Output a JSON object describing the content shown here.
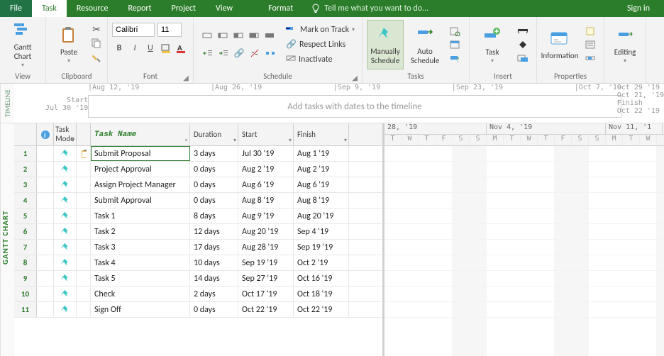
{
  "menu": {
    "file": "File",
    "task": "Task",
    "resource": "Resource",
    "report": "Report",
    "project": "Project",
    "view": "View",
    "format": "Format",
    "tellme": "Tell me what you want to do...",
    "signin": "Sign in"
  },
  "ribbon": {
    "view": {
      "gantt": "Gantt\nChart",
      "label": "View"
    },
    "clipboard": {
      "paste": "Paste",
      "label": "Clipboard"
    },
    "font": {
      "family": "Calibri",
      "size": "11",
      "label": "Font"
    },
    "schedule": {
      "markontrack": "Mark on Track",
      "respectlinks": "Respect Links",
      "inactivate": "Inactivate",
      "label": "Schedule"
    },
    "tasks": {
      "manualsched": "Manually\nSchedule",
      "autosched": "Auto\nSchedule",
      "label": "Tasks"
    },
    "insert": {
      "task": "Task",
      "label": "Insert"
    },
    "properties": {
      "information": "Information",
      "label": "Properties"
    },
    "editing": {
      "label": "Editing"
    }
  },
  "timeline": {
    "side_label": "TIMELINE",
    "start_lbl": "Start",
    "start_date": "Jul 30 '19",
    "finish_lbl": "Finish",
    "finish_date": "Oct 22 '19",
    "placeholder": "Add tasks with dates to the timeline",
    "marks": [
      "|Aug 12, '19",
      "|Aug 26, '19",
      "|Sep 9, '19",
      "|Sep 23, '19",
      "|Oct 7, '19"
    ],
    "topright": [
      "Oct 29 '19",
      "Oct 21, '19"
    ]
  },
  "sheet": {
    "side_label": "GANTT CHART",
    "cols": {
      "info": "",
      "mode": "Task\nMode",
      "name": "Task Name",
      "dur": "Duration",
      "start": "Start",
      "fin": "Finish"
    },
    "rows": [
      {
        "n": "1",
        "name": "Submit Proposal",
        "dur": "3 days",
        "start": "Jul 30 '19",
        "fin": "Aug 1 '19",
        "ind": true
      },
      {
        "n": "2",
        "name": "Project Approval",
        "dur": "0 days",
        "start": "Aug 2 '19",
        "fin": "Aug 2 '19"
      },
      {
        "n": "3",
        "name": "Assign Project Manager",
        "dur": "0 days",
        "start": "Aug 6 '19",
        "fin": "Aug 6 '19"
      },
      {
        "n": "4",
        "name": "Submit Approval",
        "dur": "0 days",
        "start": "Aug 8 '19",
        "fin": "Aug 8 '19"
      },
      {
        "n": "5",
        "name": "Task 1",
        "dur": "8 days",
        "start": "Aug 9 '19",
        "fin": "Aug 20 '19"
      },
      {
        "n": "6",
        "name": "Task 2",
        "dur": "12 days",
        "start": "Aug 20 '19",
        "fin": "Sep 4 '19"
      },
      {
        "n": "7",
        "name": "Task 3",
        "dur": "17 days",
        "start": "Aug 28 '19",
        "fin": "Sep 19 '19"
      },
      {
        "n": "8",
        "name": "Task 4",
        "dur": "10 days",
        "start": "Sep 19 '19",
        "fin": "Oct 2 '19"
      },
      {
        "n": "9",
        "name": "Task 5",
        "dur": "14 days",
        "start": "Sep 27 '19",
        "fin": "Oct 16 '19"
      },
      {
        "n": "10",
        "name": "Check",
        "dur": "2 days",
        "start": "Oct 17 '19",
        "fin": "Oct 18 '19"
      },
      {
        "n": "11",
        "name": "Sign Off",
        "dur": "0 days",
        "start": "Oct 22 '19",
        "fin": "Oct 22 '19"
      }
    ]
  },
  "gantt": {
    "weeks": [
      "28, '19",
      "Nov 4, '19",
      "Nov 11, '1"
    ],
    "days": [
      "T",
      "W",
      "T",
      "F",
      "S",
      "S",
      "M",
      "T",
      "W",
      "T",
      "F",
      "S",
      "S",
      "M",
      "T",
      "W"
    ]
  }
}
